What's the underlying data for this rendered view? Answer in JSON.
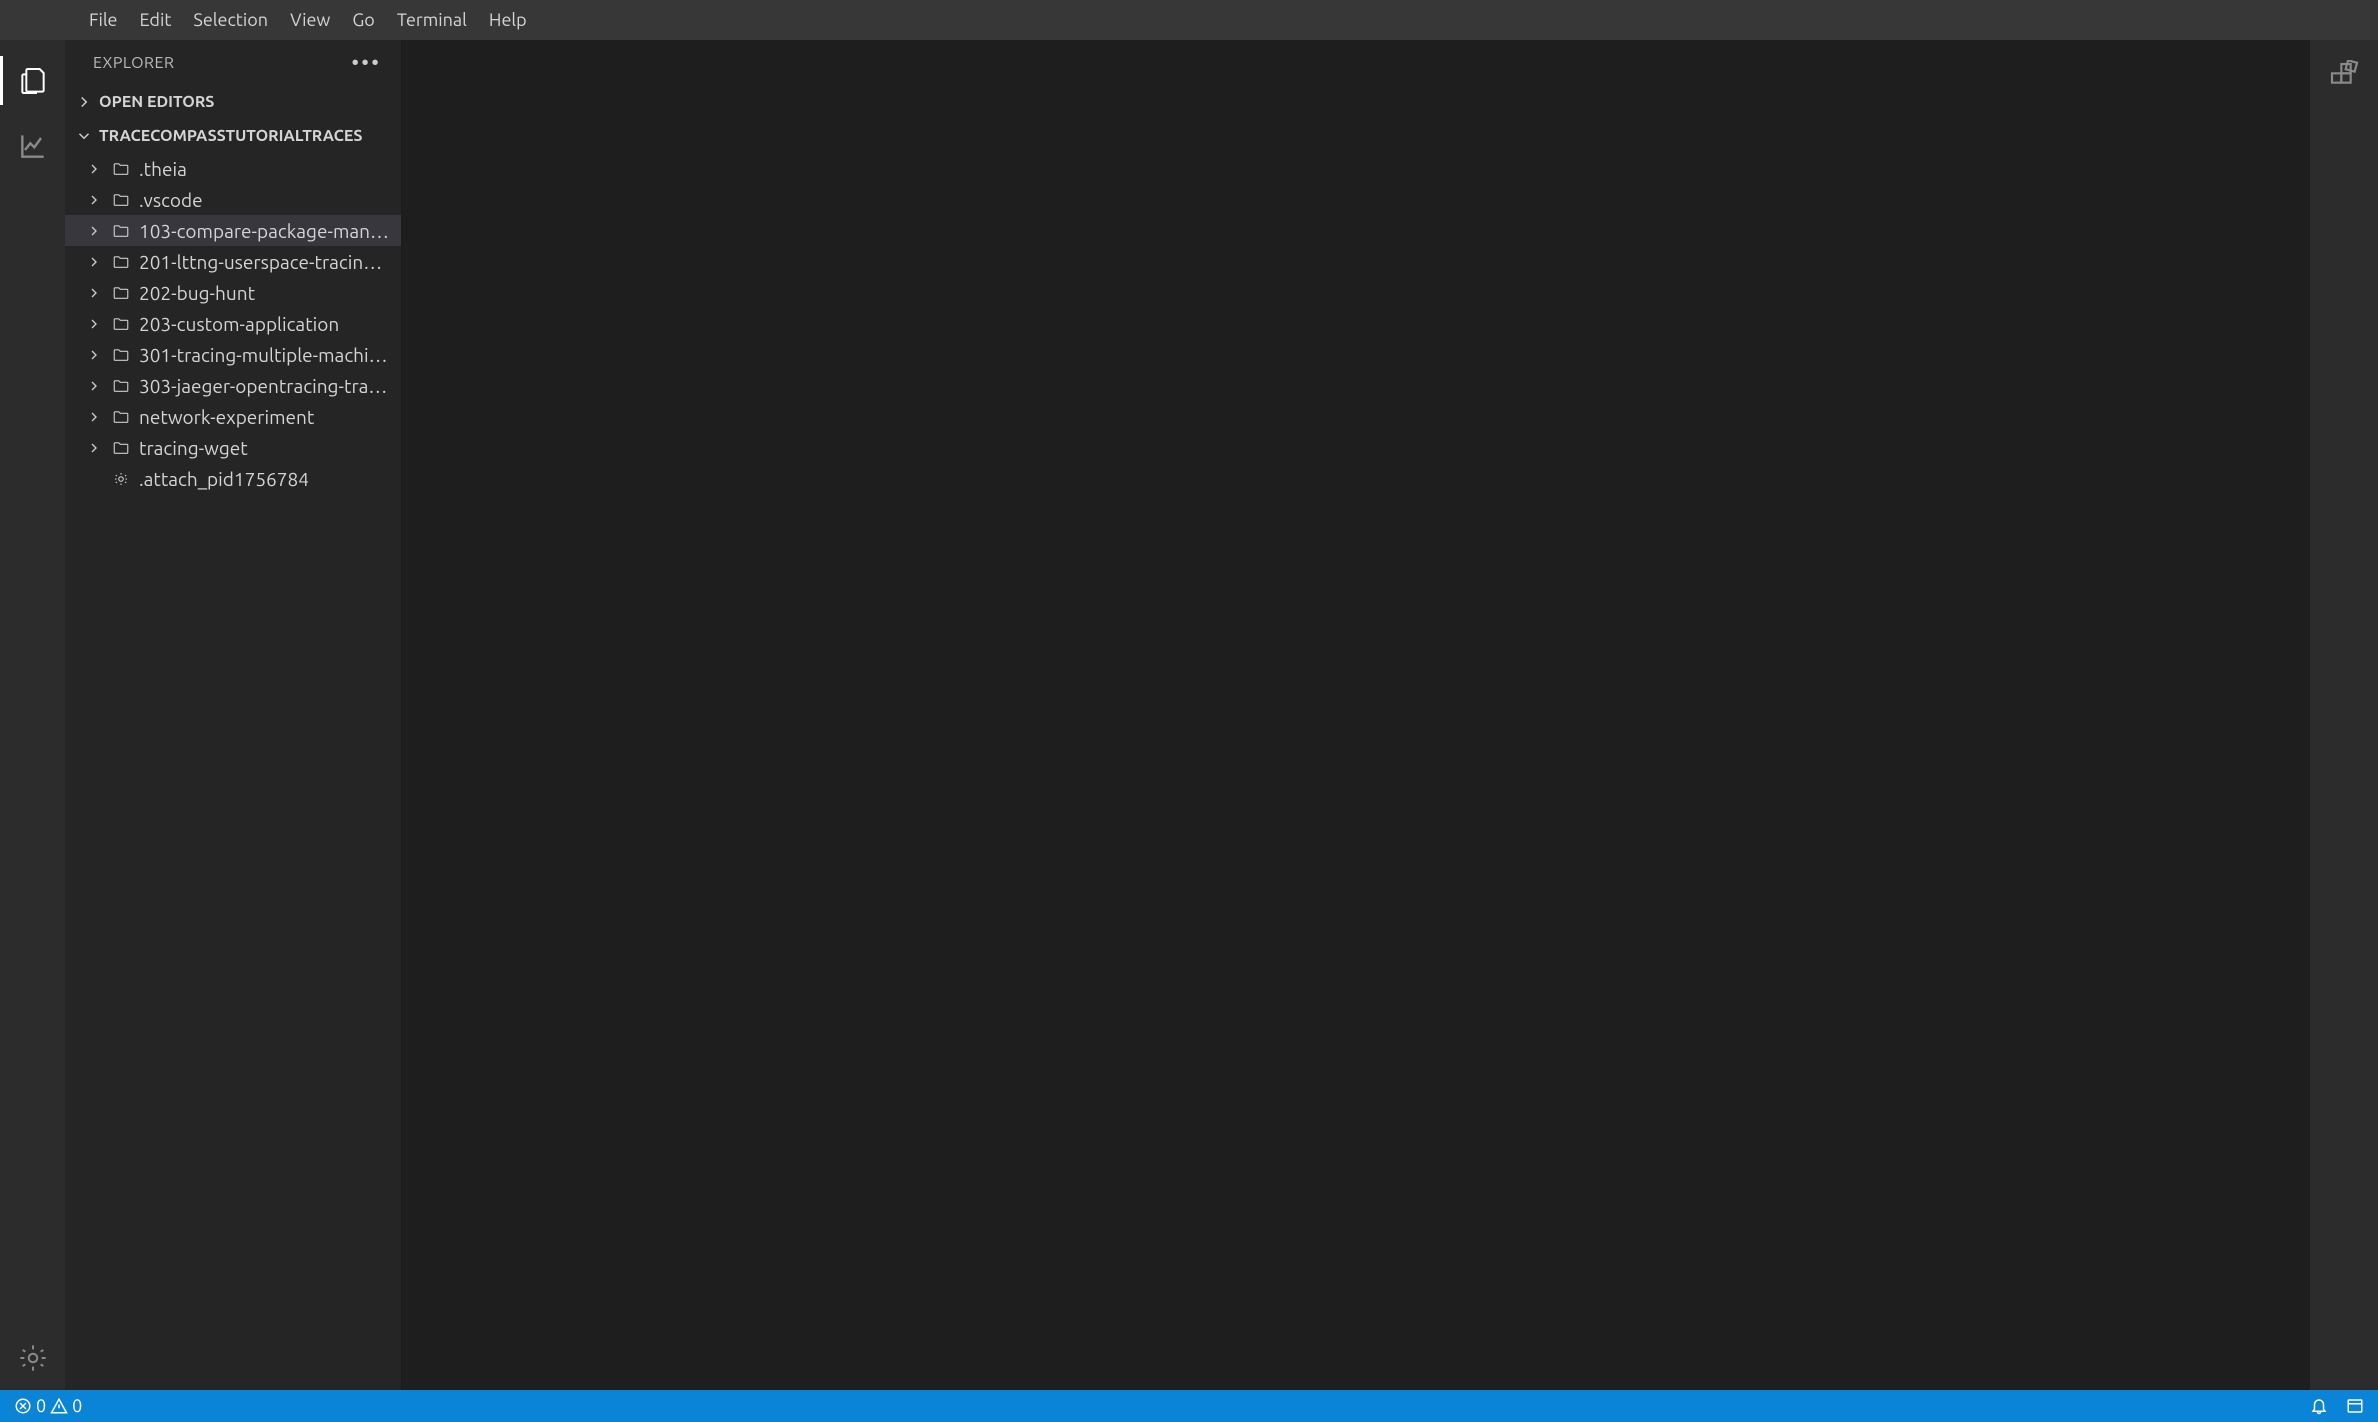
{
  "menubar": {
    "items": [
      "File",
      "Edit",
      "Selection",
      "View",
      "Go",
      "Terminal",
      "Help"
    ]
  },
  "sidebar": {
    "title": "EXPLORER",
    "open_editors_label": "OPEN EDITORS",
    "workspace_label": "TRACECOMPASSTUTORIALTRACES",
    "tree": [
      {
        "type": "folder",
        "label": ".theia",
        "selected": false
      },
      {
        "type": "folder",
        "label": ".vscode",
        "selected": false
      },
      {
        "type": "folder",
        "label": "103-compare-package-man…",
        "selected": true
      },
      {
        "type": "folder",
        "label": "201-lttng-userspace-tracin…",
        "selected": false
      },
      {
        "type": "folder",
        "label": "202-bug-hunt",
        "selected": false
      },
      {
        "type": "folder",
        "label": "203-custom-application",
        "selected": false
      },
      {
        "type": "folder",
        "label": "301-tracing-multiple-machi…",
        "selected": false
      },
      {
        "type": "folder",
        "label": "303-jaeger-opentracing-tra…",
        "selected": false
      },
      {
        "type": "folder",
        "label": "network-experiment",
        "selected": false
      },
      {
        "type": "folder",
        "label": "tracing-wget",
        "selected": false
      },
      {
        "type": "file",
        "label": ".attach_pid1756784",
        "selected": false
      }
    ]
  },
  "statusbar": {
    "errors": "0",
    "warnings": "0"
  }
}
